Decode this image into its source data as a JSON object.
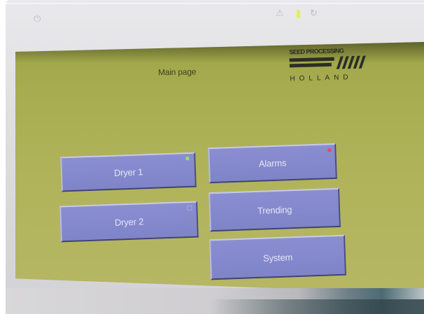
{
  "screen": {
    "title": "Main page",
    "logo": {
      "top_text": "SEED PROCESSING",
      "bottom_text": "HOLLAND"
    }
  },
  "buttons": [
    {
      "id": "dryer1",
      "label": "Dryer 1",
      "indicator_color": "#8be36a"
    },
    {
      "id": "alarms",
      "label": "Alarms",
      "indicator_color": "#e0505a"
    },
    {
      "id": "dryer2",
      "label": "Dryer 2",
      "indicator_color": "#9396c8"
    },
    {
      "id": "trending",
      "label": "Trending",
      "indicator_color": null
    },
    {
      "id": "system",
      "label": "System",
      "indicator_color": null
    }
  ],
  "colors": {
    "screen_background": "#aaae53",
    "button_fill": "#8589cc",
    "button_text": "#e4e5f6",
    "title_text": "#3f4128"
  },
  "bezel_icons": [
    "power-icon",
    "warning-icon",
    "status-led",
    "refresh-icon"
  ]
}
